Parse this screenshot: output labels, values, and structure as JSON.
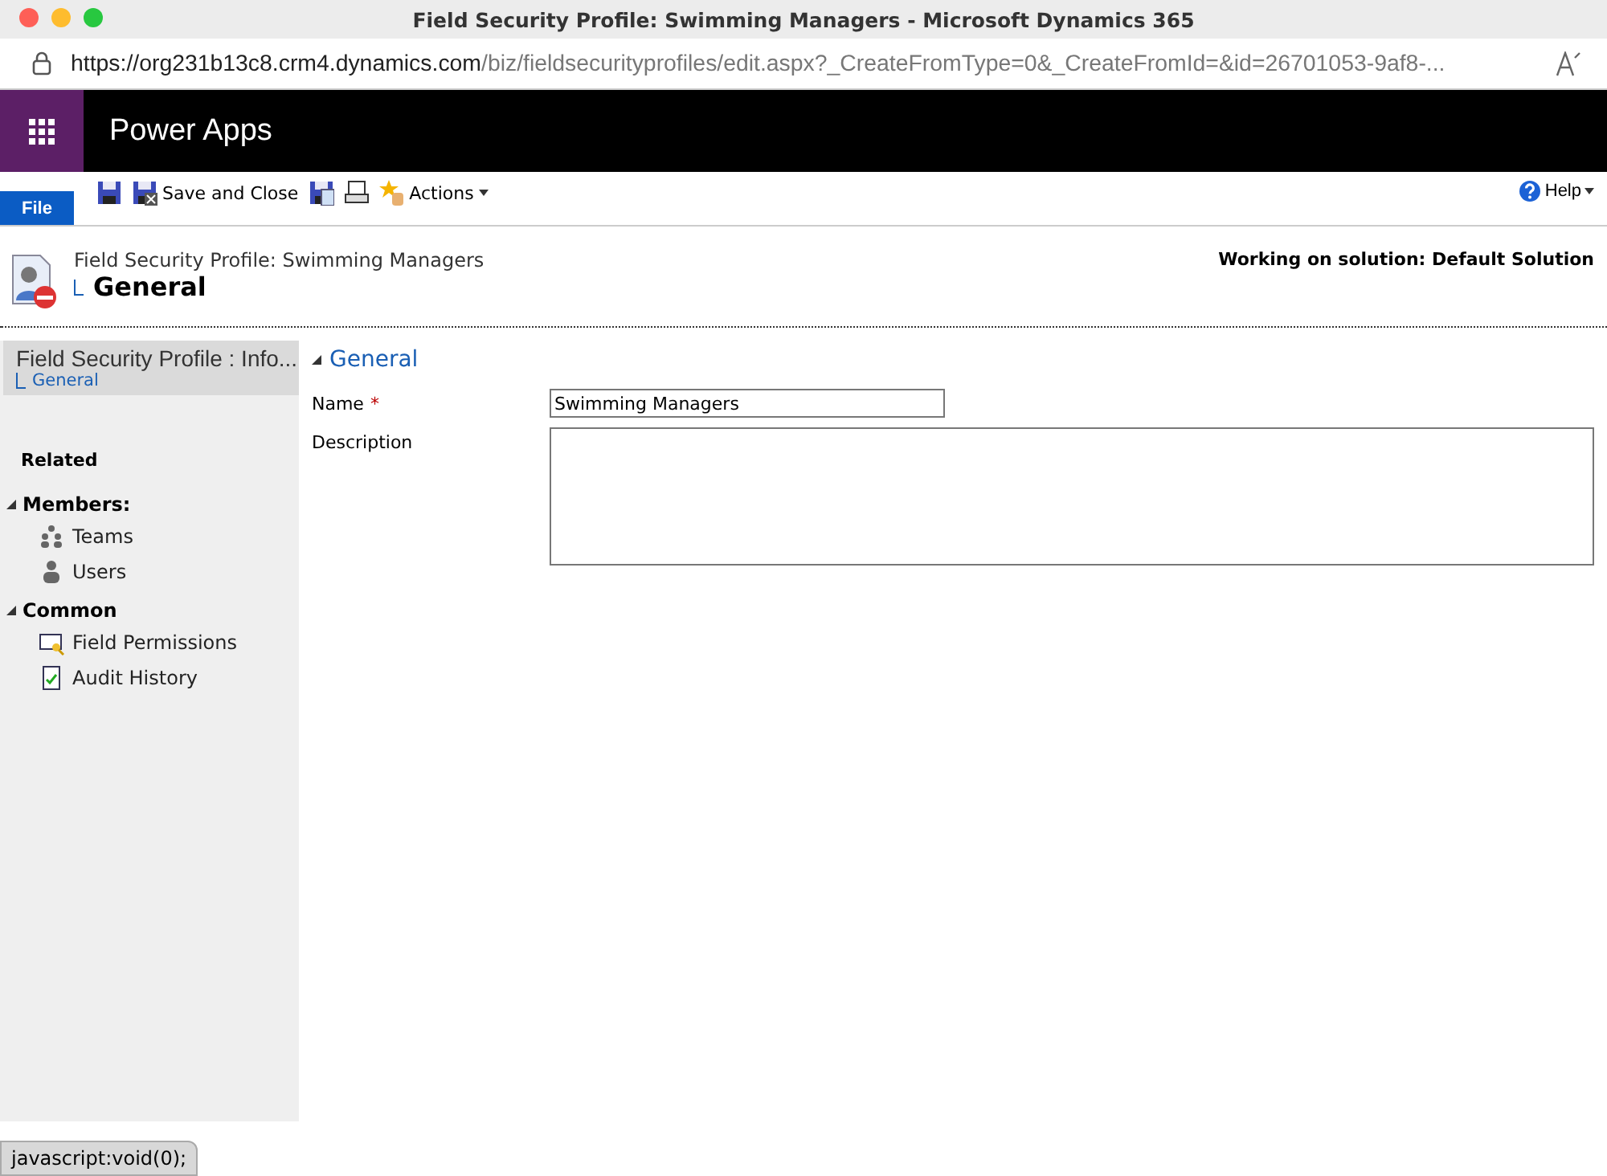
{
  "window": {
    "title": "Field Security Profile: Swimming Managers - Microsoft Dynamics 365"
  },
  "address_bar": {
    "url_host": "https://org231b13c8.crm4.dynamics.com",
    "url_path": "/biz/fieldsecurityprofiles/edit.aspx?_CreateFromType=0&_CreateFromId=&id=26701053-9af8-..."
  },
  "app_header": {
    "title": "Power Apps"
  },
  "ribbon": {
    "file_tab": "File",
    "items": [
      {
        "kind": "save"
      },
      {
        "kind": "save_close",
        "label": "Save and Close"
      },
      {
        "kind": "save_new"
      },
      {
        "kind": "print"
      },
      {
        "kind": "actions",
        "label": "Actions"
      }
    ],
    "help": "Help"
  },
  "record_header": {
    "entity": "Field Security Profile: Swimming Managers",
    "form": "General",
    "solution": "Working on solution: Default Solution"
  },
  "sidebar": {
    "form_selector": {
      "title": "Field Security Profile : Info...",
      "items": [
        {
          "label": "General",
          "selected": true
        }
      ]
    },
    "related_heading": "Related",
    "groups": [
      {
        "label": "Members:",
        "expanded": true,
        "items": [
          {
            "kind": "teams",
            "label": "Teams"
          },
          {
            "kind": "users",
            "label": "Users"
          }
        ]
      },
      {
        "label": "Common",
        "expanded": true,
        "items": [
          {
            "kind": "permissions",
            "label": "Field Permissions"
          },
          {
            "kind": "audit",
            "label": "Audit History"
          }
        ]
      }
    ]
  },
  "form": {
    "section": {
      "title": "General",
      "expanded": true
    },
    "fields": [
      {
        "kind": "text",
        "label": "Name",
        "required_mark": "*",
        "value": "Swimming Managers"
      },
      {
        "kind": "textarea",
        "label": "Description"
      }
    ]
  },
  "status_bar": {
    "text": "javascript:void(0);"
  }
}
